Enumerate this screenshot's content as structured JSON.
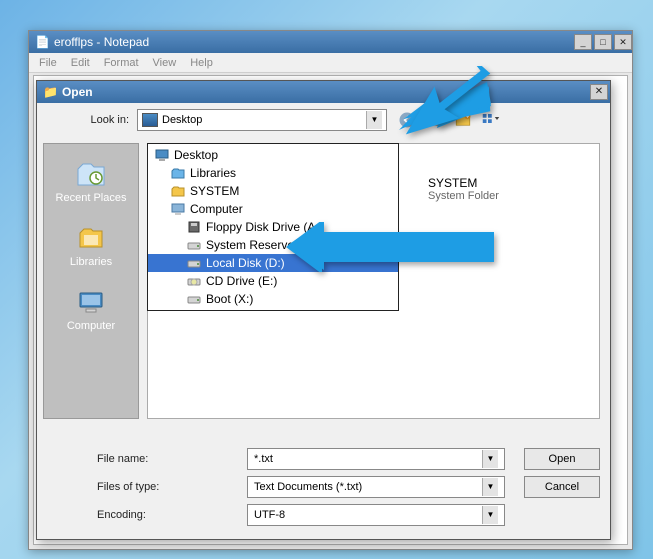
{
  "notepad": {
    "title": "erofflps - Notepad",
    "menus": [
      "File",
      "Edit",
      "Format",
      "View",
      "Help"
    ]
  },
  "dialog": {
    "title": "Open",
    "lookin_label": "Look in:",
    "lookin_value": "Desktop",
    "places": [
      {
        "label": "Recent Places",
        "icon": "recent"
      },
      {
        "label": "Libraries",
        "icon": "libraries"
      },
      {
        "label": "Computer",
        "icon": "computer"
      }
    ],
    "ghost": {
      "name": "SYSTEM",
      "type": "System Folder"
    },
    "dropdown": [
      {
        "label": "Desktop",
        "indent": 0,
        "icon": "desktop"
      },
      {
        "label": "Libraries",
        "indent": 1,
        "icon": "libraries"
      },
      {
        "label": "SYSTEM",
        "indent": 1,
        "icon": "user"
      },
      {
        "label": "Computer",
        "indent": 1,
        "icon": "computer"
      },
      {
        "label": "Floppy Disk Drive (A:)",
        "indent": 2,
        "icon": "floppy"
      },
      {
        "label": "System Reserved (C:)",
        "indent": 2,
        "icon": "drive"
      },
      {
        "label": "Local Disk (D:)",
        "indent": 2,
        "icon": "drive",
        "selected": true
      },
      {
        "label": "CD Drive (E:)",
        "indent": 2,
        "icon": "cd"
      },
      {
        "label": "Boot (X:)",
        "indent": 2,
        "icon": "drive"
      }
    ],
    "filename_label": "File name:",
    "filename_value": "*.txt",
    "filetype_label": "Files of type:",
    "filetype_value": "Text Documents (*.txt)",
    "encoding_label": "Encoding:",
    "encoding_value": "UTF-8",
    "open_btn": "Open",
    "cancel_btn": "Cancel"
  }
}
